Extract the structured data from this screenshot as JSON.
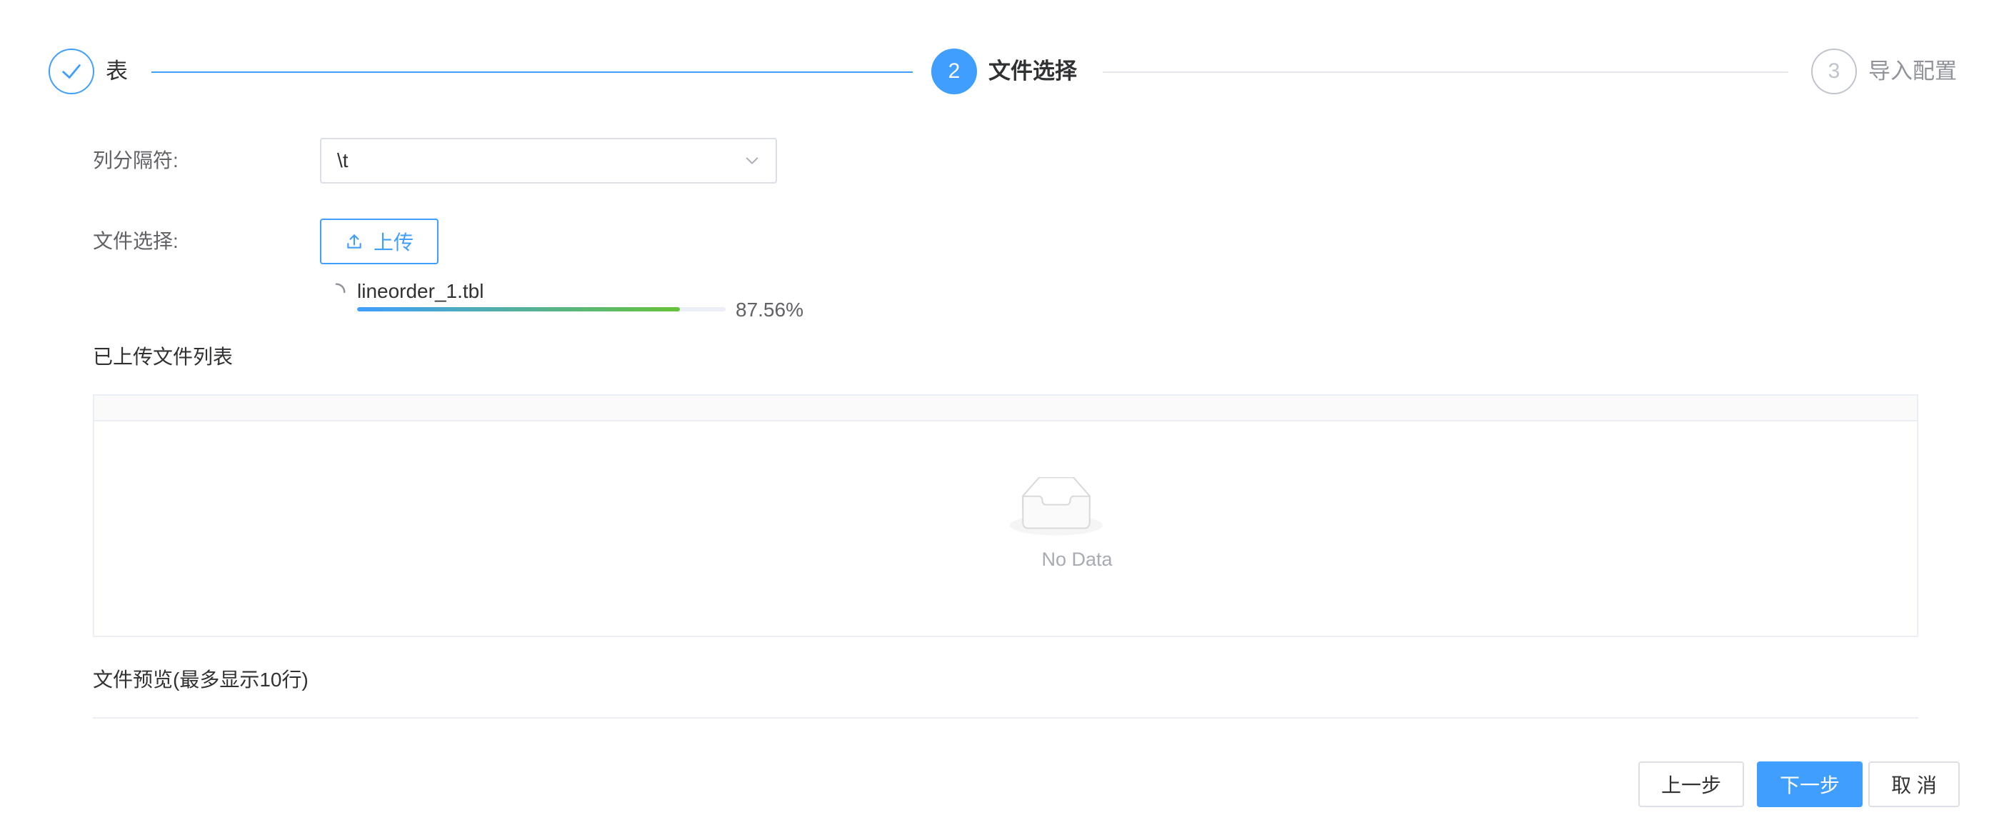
{
  "steps": [
    {
      "index": "1",
      "title": "表",
      "status": "done"
    },
    {
      "index": "2",
      "title": "文件选择",
      "status": "active"
    },
    {
      "index": "3",
      "title": "导入配置",
      "status": "wait"
    }
  ],
  "form": {
    "delimiter_label": "列分隔符:",
    "delimiter_value": "\\t",
    "file_label": "文件选择:",
    "upload_button": "上传"
  },
  "upload_progress": {
    "file_name": "lineorder_1.tbl",
    "percent_text": "87.56%",
    "percent": 87.56
  },
  "uploaded_list": {
    "title": "已上传文件列表",
    "empty_text": "No Data"
  },
  "preview": {
    "title": "文件预览(最多显示10行)"
  },
  "footer": {
    "prev_label": "上一步",
    "next_label": "下一步",
    "cancel_label": "取 消"
  },
  "colors": {
    "primary": "#409eff",
    "success": "#67c23a",
    "border": "#dcdfe6"
  },
  "icons": {
    "step1": "check-icon",
    "select_arrow": "chevron-down-icon",
    "upload": "upload-icon",
    "spinner": "loading-icon",
    "empty": "empty-box-icon"
  }
}
